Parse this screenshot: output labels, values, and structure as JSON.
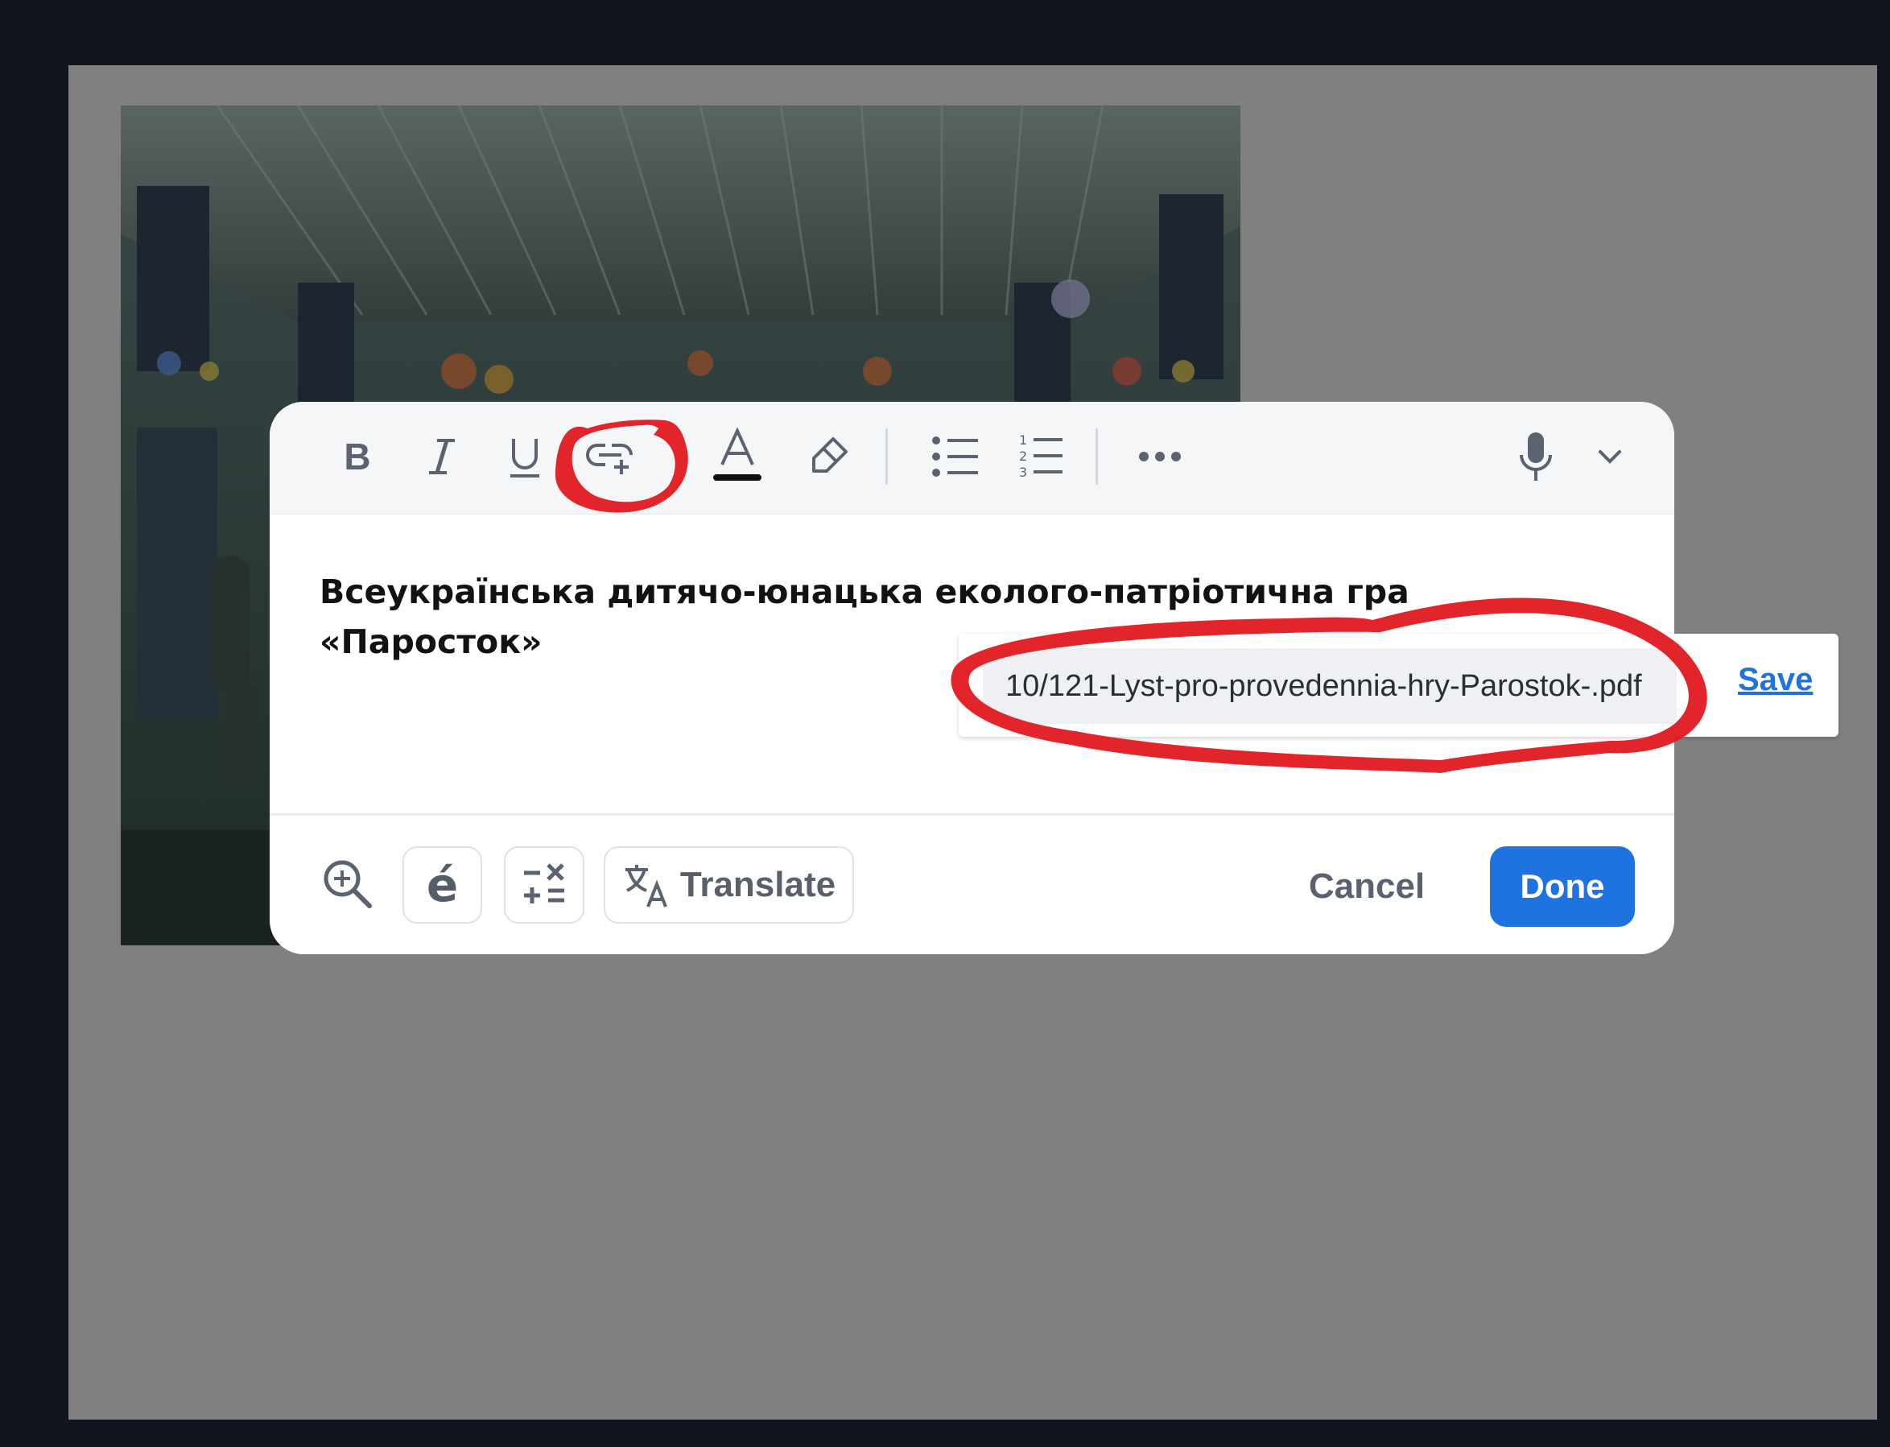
{
  "toolbar": {
    "buttons": [
      {
        "name": "bold",
        "icon": "bold-icon"
      },
      {
        "name": "italic",
        "icon": "italic-icon"
      },
      {
        "name": "underline",
        "icon": "underline-icon"
      },
      {
        "name": "insert-link",
        "icon": "link-add-icon"
      },
      {
        "name": "text-color",
        "icon": "text-color-icon"
      },
      {
        "name": "highlight",
        "icon": "highlighter-icon"
      },
      {
        "name": "bulleted-list",
        "icon": "bulleted-list-icon"
      },
      {
        "name": "numbered-list",
        "icon": "numbered-list-icon"
      },
      {
        "name": "more",
        "icon": "more-horizontal-icon"
      },
      {
        "name": "dictate",
        "icon": "microphone-icon"
      },
      {
        "name": "dictate-options",
        "icon": "chevron-down-icon"
      }
    ]
  },
  "content": {
    "line1": "Всеукраїнська дитячо-юнацька еколого-патріотична гра",
    "line2": "«Паросток»"
  },
  "link_popup": {
    "url_value": "10/121-Lyst-pro-provedennia-hry-Parostok-.pdf",
    "save_label": "Save"
  },
  "footer": {
    "accent_label": "é",
    "translate_label": "Translate",
    "cancel_label": "Cancel",
    "done_label": "Done"
  },
  "colors": {
    "accent": "#1f73e0",
    "annotation": "#e0191f",
    "overlay": "#808080"
  }
}
